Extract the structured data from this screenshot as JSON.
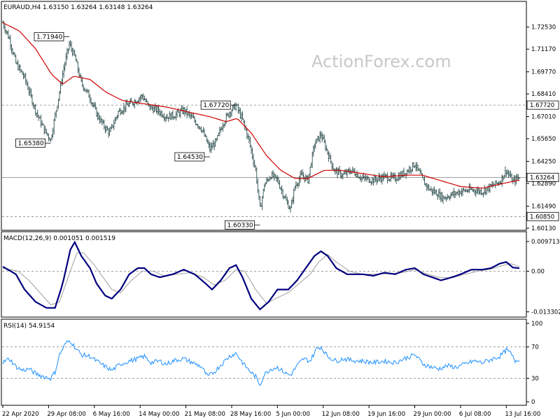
{
  "watermark": "ActionForex.com",
  "colors": {
    "bars": "#2f4f4f",
    "ma": "#d00000",
    "macd": "#00007f",
    "signal": "#a0a0a0",
    "rsi": "#1e90ff",
    "grid": "#808080"
  },
  "chart_data": [
    {
      "type": "ohlc",
      "title": "EURAUD,H4  1.63150 1.63264 1.63148 1.63264",
      "ylim": [
        1.6013,
        1.7325
      ],
      "price_ticks": [
        "1.72530",
        "1.71170",
        "1.69770",
        "1.68410",
        "1.67010",
        "1.65650",
        "1.64250",
        "1.62890",
        "1.61490",
        "1.60130"
      ],
      "price_tick_values": [
        1.7253,
        1.7117,
        1.6977,
        1.6841,
        1.6701,
        1.6565,
        1.6425,
        1.6289,
        1.6149,
        1.6013
      ],
      "x_labels": [
        "22 Apr 2020",
        "29 Apr 08:00",
        "6 May 16:00",
        "14 May 00:00",
        "21 May 08:00",
        "28 May 16:00",
        "5 Jun 00:00",
        "12 Jun 08:00",
        "19 Jun 16:00",
        "29 Jun 00:00",
        "6 Jul 08:00",
        "13 Jul 16:00"
      ],
      "x_label_index": [
        0,
        42,
        84,
        126,
        168,
        210,
        252,
        294,
        336,
        378,
        420,
        462
      ],
      "close_points": [
        [
          0,
          1.728
        ],
        [
          6,
          1.718
        ],
        [
          12,
          1.703
        ],
        [
          20,
          1.694
        ],
        [
          30,
          1.674
        ],
        [
          38,
          1.662
        ],
        [
          44,
          1.656
        ],
        [
          50,
          1.678
        ],
        [
          56,
          1.7
        ],
        [
          61,
          1.715
        ],
        [
          66,
          1.707
        ],
        [
          72,
          1.691
        ],
        [
          80,
          1.682
        ],
        [
          86,
          1.672
        ],
        [
          92,
          1.665
        ],
        [
          98,
          1.66
        ],
        [
          106,
          1.673
        ],
        [
          114,
          1.677
        ],
        [
          122,
          1.68
        ],
        [
          128,
          1.683
        ],
        [
          134,
          1.676
        ],
        [
          142,
          1.674
        ],
        [
          150,
          1.67
        ],
        [
          158,
          1.671
        ],
        [
          166,
          1.674
        ],
        [
          174,
          1.669
        ],
        [
          182,
          1.663
        ],
        [
          190,
          1.65
        ],
        [
          196,
          1.655
        ],
        [
          202,
          1.666
        ],
        [
          208,
          1.673
        ],
        [
          214,
          1.677
        ],
        [
          220,
          1.668
        ],
        [
          226,
          1.655
        ],
        [
          232,
          1.637
        ],
        [
          236,
          1.613
        ],
        [
          240,
          1.628
        ],
        [
          246,
          1.634
        ],
        [
          252,
          1.631
        ],
        [
          260,
          1.618
        ],
        [
          264,
          1.613
        ],
        [
          268,
          1.627
        ],
        [
          274,
          1.634
        ],
        [
          280,
          1.631
        ],
        [
          286,
          1.653
        ],
        [
          292,
          1.659
        ],
        [
          298,
          1.648
        ],
        [
          304,
          1.637
        ],
        [
          312,
          1.634
        ],
        [
          320,
          1.637
        ],
        [
          330,
          1.632
        ],
        [
          340,
          1.631
        ],
        [
          350,
          1.633
        ],
        [
          360,
          1.632
        ],
        [
          370,
          1.636
        ],
        [
          378,
          1.641
        ],
        [
          386,
          1.63
        ],
        [
          392,
          1.625
        ],
        [
          398,
          1.623
        ],
        [
          404,
          1.62
        ],
        [
          412,
          1.622
        ],
        [
          420,
          1.624
        ],
        [
          430,
          1.625
        ],
        [
          440,
          1.624
        ],
        [
          448,
          1.627
        ],
        [
          456,
          1.63
        ],
        [
          462,
          1.637
        ],
        [
          468,
          1.63
        ],
        [
          474,
          1.633
        ]
      ],
      "ma_points": [
        [
          0,
          1.728
        ],
        [
          15,
          1.723
        ],
        [
          30,
          1.712
        ],
        [
          45,
          1.696
        ],
        [
          55,
          1.69
        ],
        [
          65,
          1.695
        ],
        [
          80,
          1.693
        ],
        [
          95,
          1.685
        ],
        [
          110,
          1.68
        ],
        [
          130,
          1.678
        ],
        [
          150,
          1.676
        ],
        [
          170,
          1.673
        ],
        [
          190,
          1.67
        ],
        [
          205,
          1.667
        ],
        [
          215,
          1.669
        ],
        [
          228,
          1.66
        ],
        [
          242,
          1.646
        ],
        [
          255,
          1.637
        ],
        [
          268,
          1.632
        ],
        [
          280,
          1.632
        ],
        [
          295,
          1.637
        ],
        [
          310,
          1.637
        ],
        [
          330,
          1.635
        ],
        [
          350,
          1.633
        ],
        [
          370,
          1.634
        ],
        [
          385,
          1.634
        ],
        [
          400,
          1.631
        ],
        [
          420,
          1.627
        ],
        [
          440,
          1.626
        ],
        [
          460,
          1.629
        ],
        [
          474,
          1.631
        ]
      ],
      "total_bars": 475,
      "hlines": [
        {
          "value": 1.6772,
          "label": "1.67720",
          "style": "dashed"
        },
        {
          "value": 1.6085,
          "label": "1.60850",
          "style": "dashed"
        },
        {
          "value": 1.63264,
          "label": "1.63264",
          "style": "solid"
        }
      ],
      "annotations": [
        {
          "label": "1.71940",
          "index": 61,
          "value": 1.7194
        },
        {
          "label": "1.65380",
          "index": 44,
          "value": 1.6538
        },
        {
          "label": "1.67720",
          "index": 214,
          "value": 1.6772
        },
        {
          "label": "1.64530",
          "index": 190,
          "value": 1.6453
        },
        {
          "label": "1.60330",
          "index": 236,
          "value": 1.6033
        }
      ]
    },
    {
      "type": "line",
      "title": "MACD(12,26,9) 0.001051 0.001519",
      "ylim": [
        -0.01433,
        0.00971
      ],
      "ticks": [
        "0.009713",
        "0.00",
        "-0.013302"
      ],
      "tick_values": [
        0.009713,
        0.0,
        -0.013302
      ],
      "macd_points": [
        [
          0,
          0.0015
        ],
        [
          12,
          -0.001
        ],
        [
          20,
          -0.006
        ],
        [
          30,
          -0.01
        ],
        [
          40,
          -0.012
        ],
        [
          48,
          -0.012
        ],
        [
          55,
          -0.004
        ],
        [
          62,
          0.007
        ],
        [
          66,
          0.0095
        ],
        [
          72,
          0.005
        ],
        [
          80,
          0.001
        ],
        [
          86,
          -0.004
        ],
        [
          94,
          -0.008
        ],
        [
          100,
          -0.009
        ],
        [
          108,
          -0.006
        ],
        [
          116,
          -0.001
        ],
        [
          124,
          0.001
        ],
        [
          130,
          0.001
        ],
        [
          136,
          -0.001
        ],
        [
          144,
          -0.002
        ],
        [
          156,
          -0.001
        ],
        [
          166,
          0.0005
        ],
        [
          176,
          -0.001
        ],
        [
          186,
          -0.004
        ],
        [
          192,
          -0.006
        ],
        [
          200,
          -0.003
        ],
        [
          208,
          0.001
        ],
        [
          214,
          0.002
        ],
        [
          220,
          -0.002
        ],
        [
          228,
          -0.009
        ],
        [
          236,
          -0.0125
        ],
        [
          244,
          -0.01
        ],
        [
          252,
          -0.006
        ],
        [
          262,
          -0.006
        ],
        [
          270,
          -0.003
        ],
        [
          278,
          0.001
        ],
        [
          286,
          0.005
        ],
        [
          292,
          0.0065
        ],
        [
          298,
          0.005
        ],
        [
          306,
          0.001
        ],
        [
          316,
          -0.001
        ],
        [
          330,
          -0.001
        ],
        [
          340,
          -0.0015
        ],
        [
          350,
          -0.0005
        ],
        [
          360,
          -0.001
        ],
        [
          370,
          0.0005
        ],
        [
          378,
          0.001
        ],
        [
          386,
          -0.001
        ],
        [
          394,
          -0.002
        ],
        [
          402,
          -0.003
        ],
        [
          412,
          -0.002
        ],
        [
          420,
          -0.001
        ],
        [
          430,
          0.0005
        ],
        [
          440,
          0.0005
        ],
        [
          448,
          0.001
        ],
        [
          456,
          0.0025
        ],
        [
          462,
          0.003
        ],
        [
          468,
          0.0012
        ],
        [
          474,
          0.001
        ]
      ],
      "signal_points": [
        [
          0,
          0.001
        ],
        [
          14,
          0.0
        ],
        [
          24,
          -0.003
        ],
        [
          34,
          -0.007
        ],
        [
          44,
          -0.011
        ],
        [
          52,
          -0.01
        ],
        [
          60,
          -0.002
        ],
        [
          68,
          0.006
        ],
        [
          74,
          0.006
        ],
        [
          84,
          0.002
        ],
        [
          92,
          -0.002
        ],
        [
          100,
          -0.006
        ],
        [
          108,
          -0.007
        ],
        [
          118,
          -0.003
        ],
        [
          128,
          0.0
        ],
        [
          138,
          0.0
        ],
        [
          148,
          -0.0015
        ],
        [
          160,
          -0.001
        ],
        [
          172,
          -0.0005
        ],
        [
          184,
          -0.002
        ],
        [
          194,
          -0.0045
        ],
        [
          204,
          -0.003
        ],
        [
          214,
          0.0005
        ],
        [
          222,
          0.0
        ],
        [
          232,
          -0.006
        ],
        [
          242,
          -0.0105
        ],
        [
          250,
          -0.009
        ],
        [
          262,
          -0.007
        ],
        [
          272,
          -0.004
        ],
        [
          282,
          -0.001
        ],
        [
          290,
          0.003
        ],
        [
          298,
          0.0055
        ],
        [
          306,
          0.003
        ],
        [
          318,
          0.0
        ],
        [
          330,
          -0.001
        ],
        [
          342,
          -0.001
        ],
        [
          354,
          -0.0008
        ],
        [
          366,
          -0.0005
        ],
        [
          378,
          0.0005
        ],
        [
          390,
          -0.001
        ],
        [
          400,
          -0.002
        ],
        [
          412,
          -0.0022
        ],
        [
          424,
          -0.001
        ],
        [
          436,
          0.0
        ],
        [
          448,
          0.0007
        ],
        [
          458,
          0.0018
        ],
        [
          466,
          0.0025
        ],
        [
          474,
          0.0015
        ]
      ]
    },
    {
      "type": "line",
      "title": "RSI(14) 54.9154",
      "ylim": [
        0,
        100
      ],
      "ticks": [
        "100",
        "70",
        "30",
        "0"
      ],
      "tick_values": [
        100,
        70,
        30,
        0
      ],
      "levels": [
        70,
        30
      ],
      "rsi_points": [
        [
          0,
          50
        ],
        [
          6,
          55
        ],
        [
          12,
          45
        ],
        [
          18,
          40
        ],
        [
          24,
          42
        ],
        [
          30,
          36
        ],
        [
          38,
          32
        ],
        [
          44,
          30
        ],
        [
          48,
          38
        ],
        [
          52,
          60
        ],
        [
          58,
          75
        ],
        [
          62,
          78
        ],
        [
          66,
          70
        ],
        [
          72,
          60
        ],
        [
          80,
          58
        ],
        [
          88,
          50
        ],
        [
          94,
          45
        ],
        [
          100,
          40
        ],
        [
          108,
          48
        ],
        [
          116,
          52
        ],
        [
          124,
          55
        ],
        [
          130,
          58
        ],
        [
          136,
          50
        ],
        [
          144,
          52
        ],
        [
          150,
          48
        ],
        [
          158,
          53
        ],
        [
          166,
          55
        ],
        [
          174,
          50
        ],
        [
          182,
          45
        ],
        [
          188,
          32
        ],
        [
          194,
          38
        ],
        [
          202,
          50
        ],
        [
          208,
          58
        ],
        [
          214,
          62
        ],
        [
          220,
          50
        ],
        [
          226,
          40
        ],
        [
          232,
          32
        ],
        [
          236,
          22
        ],
        [
          240,
          35
        ],
        [
          246,
          42
        ],
        [
          252,
          44
        ],
        [
          260,
          36
        ],
        [
          264,
          34
        ],
        [
          270,
          46
        ],
        [
          276,
          55
        ],
        [
          282,
          52
        ],
        [
          288,
          68
        ],
        [
          292,
          70
        ],
        [
          298,
          58
        ],
        [
          306,
          52
        ],
        [
          312,
          55
        ],
        [
          320,
          53
        ],
        [
          330,
          52
        ],
        [
          340,
          50
        ],
        [
          350,
          52
        ],
        [
          360,
          50
        ],
        [
          370,
          56
        ],
        [
          378,
          60
        ],
        [
          386,
          48
        ],
        [
          394,
          44
        ],
        [
          400,
          42
        ],
        [
          408,
          46
        ],
        [
          416,
          44
        ],
        [
          424,
          48
        ],
        [
          432,
          52
        ],
        [
          440,
          50
        ],
        [
          448,
          54
        ],
        [
          456,
          58
        ],
        [
          462,
          66
        ],
        [
          466,
          62
        ],
        [
          470,
          52
        ],
        [
          474,
          54.9
        ]
      ]
    }
  ]
}
